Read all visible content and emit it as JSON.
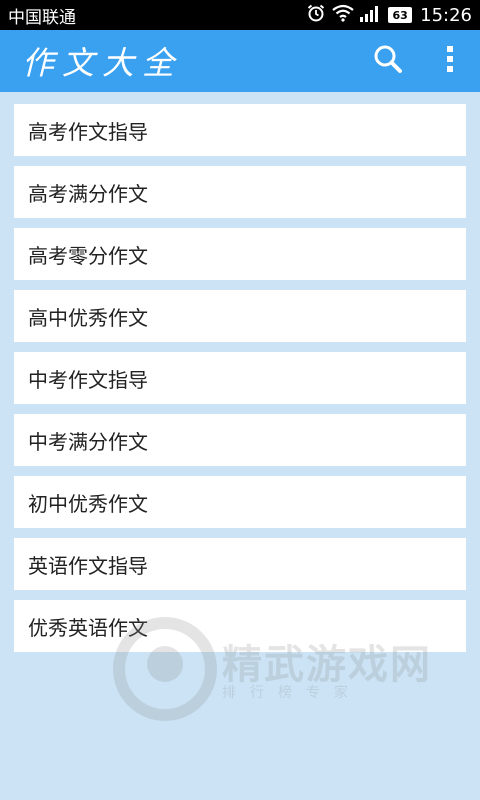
{
  "status_bar": {
    "carrier": "中国联通",
    "battery": "63",
    "time": "15:26"
  },
  "app_bar": {
    "title": "作文大全",
    "icons": [
      "search-icon",
      "more-vert-icon"
    ]
  },
  "list": {
    "items": [
      {
        "label": "高考作文指导"
      },
      {
        "label": "高考满分作文"
      },
      {
        "label": "高考零分作文"
      },
      {
        "label": "高中优秀作文"
      },
      {
        "label": "中考作文指导"
      },
      {
        "label": "中考满分作文"
      },
      {
        "label": "初中优秀作文"
      },
      {
        "label": "英语作文指导"
      },
      {
        "label": "优秀英语作文"
      }
    ]
  },
  "watermark": {
    "title": "精武游戏网",
    "subtitle": "排行榜专家"
  },
  "colors": {
    "app_bar": "#3aa0f0",
    "background": "#cbe3f5",
    "item": "#ffffff"
  }
}
